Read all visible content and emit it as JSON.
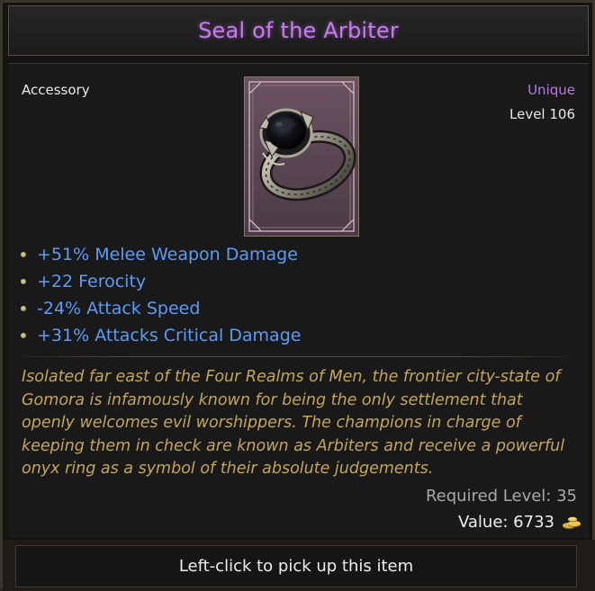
{
  "item": {
    "name": "Seal of the Arbiter",
    "type": "Accessory",
    "rarity": "Unique",
    "level": "Level 106",
    "icon": "onyx-ring-icon",
    "name_color": "#c77ce8",
    "stat_color": "#5c9cf6",
    "lore_color": "#c4a657"
  },
  "stats": [
    "+51% Melee Weapon Damage",
    "+22 Ferocity",
    "-24% Attack Speed",
    "+31% Attacks Critical Damage"
  ],
  "lore": [
    "Isolated far east of the Four Realms of Men, the frontier city-state of",
    "Gomora is infamously known for being the only settlement that",
    "openly welcomes evil worshippers. The champions in charge of",
    "keeping them in check are known as Arbiters and receive a powerful",
    "onyx ring as a symbol of their absolute judgements."
  ],
  "requirements": {
    "required_level": "Required Level: 35",
    "value": "Value: 6733",
    "currency_icon": "gold-coins-icon"
  },
  "footer": {
    "hint": "Left-click to pick up this item"
  }
}
